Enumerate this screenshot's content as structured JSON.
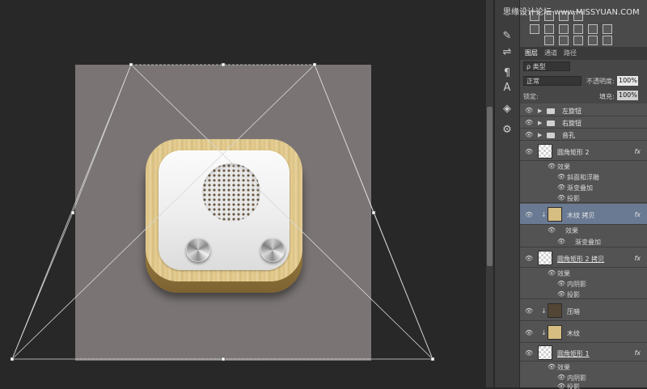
{
  "site_watermark": "思缘设计论坛 www.MISSYUAN.COM",
  "layers_panel": {
    "tabs": [
      "图层",
      "通道",
      "路径"
    ],
    "filter_kind": "ρ 类型",
    "blend_mode": "正常",
    "opacity_label": "不透明度:",
    "opacity_value": "100%",
    "lock_label": "锁定:",
    "fill_label": "填充:",
    "fill_value": "100%",
    "fx_label": "fx",
    "layers": [
      {
        "label": "左旋钮"
      },
      {
        "label": "右旋钮"
      },
      {
        "label": "音孔"
      },
      {
        "label": "圆角矩形 2"
      },
      {
        "label": "效果"
      },
      {
        "label": "斜面和浮雕"
      },
      {
        "label": "渐变叠加"
      },
      {
        "label": "投影"
      },
      {
        "label": "木纹 拷贝"
      },
      {
        "label": "效果"
      },
      {
        "label": "渐变叠加"
      },
      {
        "label": "圆角矩形 2 拷贝"
      },
      {
        "label": "效果"
      },
      {
        "label": "内阴影"
      },
      {
        "label": "投影"
      },
      {
        "label": "压暗"
      },
      {
        "label": "木纹"
      },
      {
        "label": "圆角矩形 1"
      },
      {
        "label": "效果"
      },
      {
        "label": "内阴影"
      },
      {
        "label": "投影"
      }
    ]
  },
  "icons": {
    "eye": "eye-icon",
    "folder": "folder-icon",
    "effects": "effects-icon",
    "link": "clipping-link-icon"
  },
  "colors": {
    "canvas_bg": "#282828",
    "document_bg": "#7a7474",
    "selected_row": "#6a7a93",
    "wood_light": "#e6cf96"
  }
}
